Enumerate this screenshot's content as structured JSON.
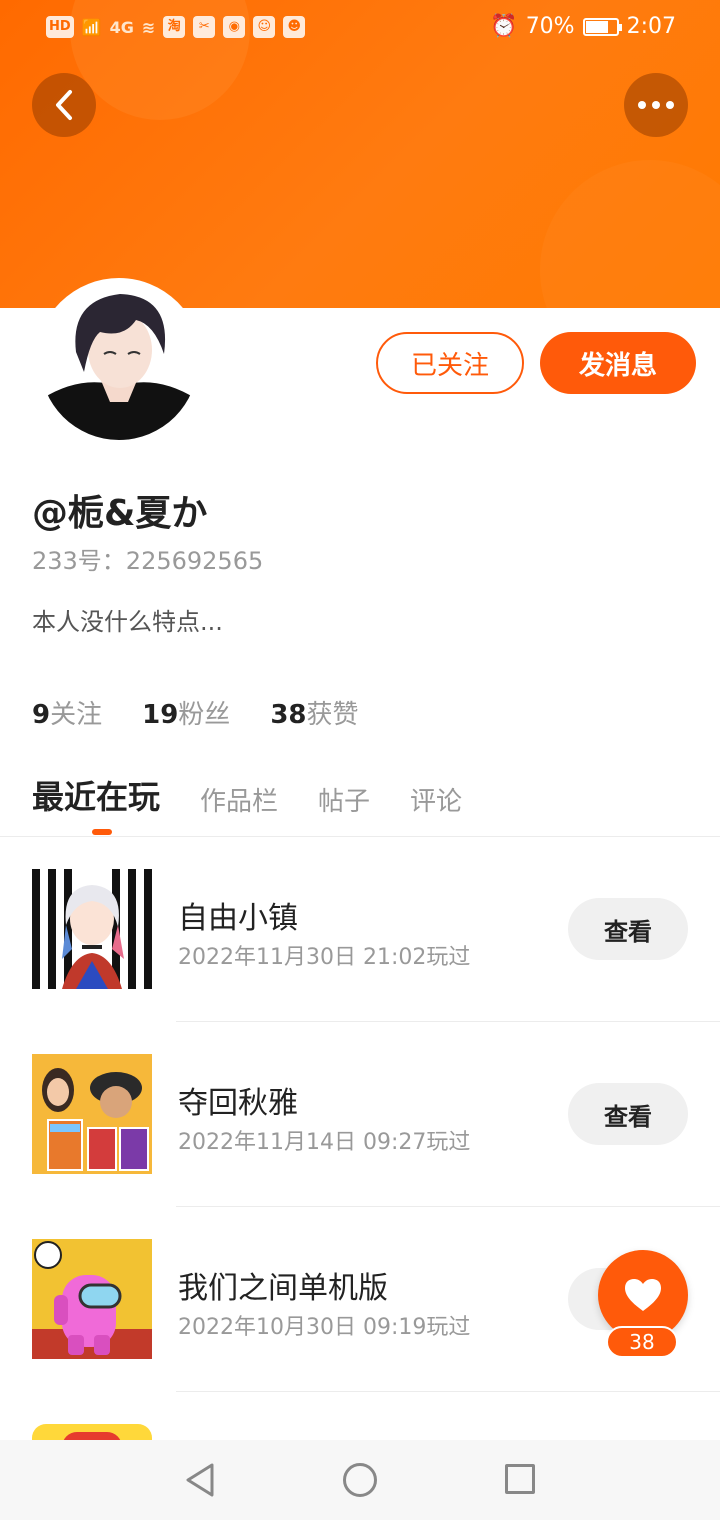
{
  "status_bar": {
    "left_icons": [
      "HD",
      "signal-x",
      "4G",
      "wifi",
      "淘",
      "capcut",
      "app-icon",
      "app-icon",
      "app-icon"
    ],
    "battery": "70%",
    "time": "2:07"
  },
  "colors": {
    "accent": "#ff5a0a",
    "header": "#ff7010"
  },
  "profile": {
    "username": "@栀&夏か",
    "uid": "233号：225692565",
    "bio": "本人没什么特点...",
    "follow_button": "已关注",
    "message_button": "发消息"
  },
  "stats": [
    {
      "num": "9",
      "label": "关注"
    },
    {
      "num": "19",
      "label": "粉丝"
    },
    {
      "num": "38",
      "label": "获赞"
    }
  ],
  "tabs": [
    "最近在玩",
    "作品栏",
    "帖子",
    "评论"
  ],
  "games": [
    {
      "name": "自由小镇",
      "played": "2022年11月30日 21:02玩过",
      "button": "查看"
    },
    {
      "name": "夺回秋雅",
      "played": "2022年11月14日 09:27玩过",
      "button": "查看"
    },
    {
      "name": "我们之间单机版",
      "played": "2022年10月30日 09:19玩过",
      "button": "查看"
    }
  ],
  "like_fab": {
    "icon": "heart-icon",
    "count": "38"
  }
}
